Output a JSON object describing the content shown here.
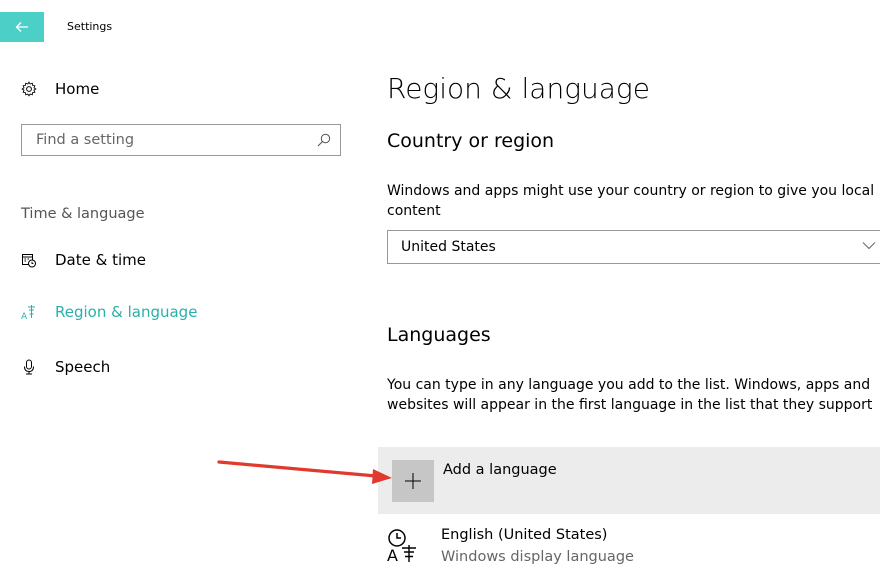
{
  "window": {
    "title": "Settings"
  },
  "sidebar": {
    "home_label": "Home",
    "search_placeholder": "Find a setting",
    "section_label": "Time & language",
    "items": [
      {
        "label": "Date & time",
        "icon": "calendar-clock-icon"
      },
      {
        "label": "Region & language",
        "icon": "language-icon",
        "active": true
      },
      {
        "label": "Speech",
        "icon": "microphone-icon"
      }
    ]
  },
  "main": {
    "title": "Region & language",
    "country": {
      "heading": "Country or region",
      "description": "Windows and apps might use your country or region to give you local content",
      "selected": "United States"
    },
    "languages": {
      "heading": "Languages",
      "description": "You can type in any language you add to the list. Windows, apps and websites will appear in the first language in the list that they support",
      "add_label": "Add a language",
      "list": [
        {
          "name": "English (United States)",
          "subtitle": "Windows display language"
        }
      ]
    }
  },
  "colors": {
    "accent": "#2ab0aa",
    "back_button": "#4ccfc7",
    "annotation_arrow": "#e03a2e"
  }
}
